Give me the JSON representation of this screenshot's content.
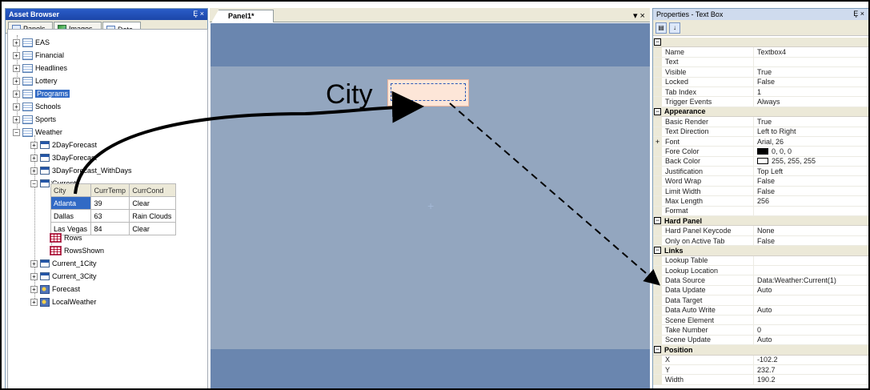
{
  "asset_browser": {
    "title": "Asset Browser",
    "controls": "Ȩ ×",
    "tabs": [
      {
        "label": "Panels"
      },
      {
        "label": "Images"
      },
      {
        "label": "Data"
      }
    ],
    "tree": {
      "eas": "EAS",
      "financial": "Financial",
      "headlines": "Headlines",
      "lottery": "Lottery",
      "programs": "Programs",
      "schools": "Schools",
      "sports": "Sports",
      "weather": "Weather",
      "d2": "2DayForecast",
      "d3": "3DayForecast",
      "d3w": "3DayForecast_WithDays",
      "current": "Current",
      "rows": "Rows",
      "rowsshown": "RowsShown",
      "current1": "Current_1City",
      "current3": "Current_3City",
      "forecast": "Forecast",
      "localweather": "LocalWeather"
    },
    "table": {
      "headers": [
        "City",
        "CurrTemp",
        "CurrCond"
      ],
      "rows": [
        [
          "Atlanta",
          "39",
          "Clear"
        ],
        [
          "Dallas",
          "63",
          "Rain Clouds"
        ],
        [
          "Las Vegas",
          "84",
          "Clear"
        ]
      ]
    }
  },
  "panel": {
    "tab": "Panel1*",
    "controls": "▾ ×",
    "city_text": "City",
    "center_plus": "+"
  },
  "properties": {
    "title": "Properties - Text Box",
    "controls": "Ȩ ×",
    "general": [
      [
        "Name",
        "Textbox4"
      ],
      [
        "Text",
        ""
      ],
      [
        "Visible",
        "True"
      ],
      [
        "Locked",
        "False"
      ],
      [
        "Tab Index",
        "1"
      ],
      [
        "Trigger Events",
        "Always"
      ]
    ],
    "appearance_label": "Appearance",
    "appearance": [
      [
        "Basic Render",
        "True"
      ],
      [
        "Text Direction",
        "Left to Right"
      ],
      [
        "Font",
        "Arial, 26"
      ],
      [
        "Fore Color",
        "0, 0, 0"
      ],
      [
        "Back Color",
        "255, 255, 255"
      ],
      [
        "Justification",
        "Top Left"
      ],
      [
        "Word Wrap",
        "False"
      ],
      [
        "Limit Width",
        "False"
      ],
      [
        "Max Length",
        "256"
      ],
      [
        "Format",
        ""
      ]
    ],
    "hard_panel_label": "Hard Panel",
    "hard_panel": [
      [
        "Hard Panel Keycode",
        "None"
      ],
      [
        "Only on Active Tab",
        "False"
      ]
    ],
    "links_label": "Links",
    "links": [
      [
        "Lookup Table",
        ""
      ],
      [
        "Lookup Location",
        ""
      ],
      [
        "Data Source",
        "Data:Weather:Current(1)"
      ],
      [
        "Data Update",
        "Auto"
      ],
      [
        "Data Target",
        ""
      ],
      [
        "Data Auto Write",
        "Auto"
      ],
      [
        "Scene Element",
        ""
      ],
      [
        "Take Number",
        "0"
      ],
      [
        "Scene Update",
        "Auto"
      ]
    ],
    "position_label": "Position",
    "position": [
      [
        "X",
        "-102.2"
      ],
      [
        "Y",
        "232.7"
      ],
      [
        "Width",
        "190.2"
      ]
    ],
    "colors": {
      "fore": "#000000",
      "back": "#ffffff"
    }
  }
}
